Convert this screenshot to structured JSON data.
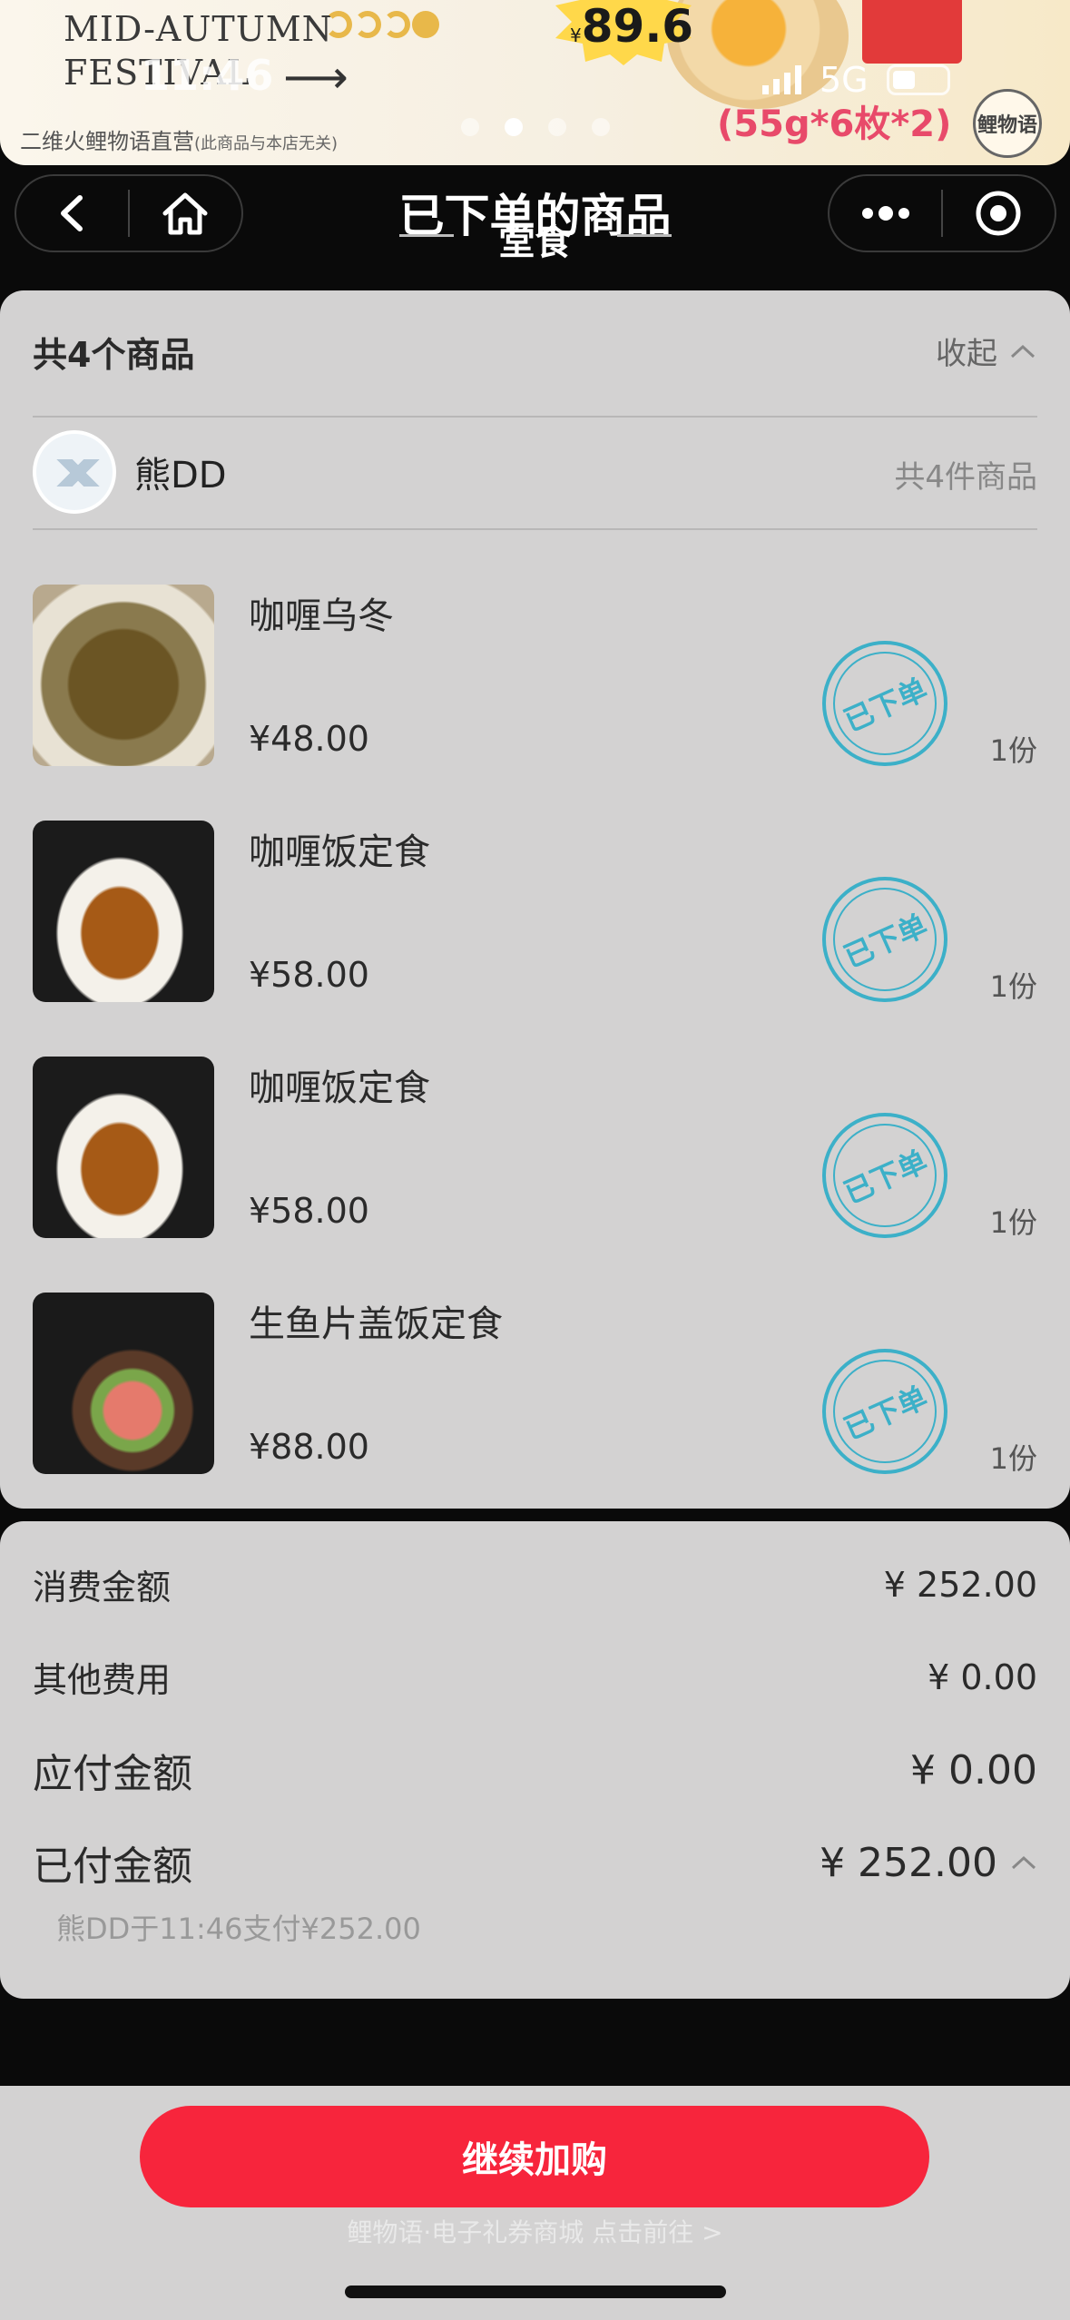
{
  "banner": {
    "headline_1": "MID-AUTUMN",
    "headline_2": "FESTIVAL",
    "shop": "二维火鲤物语直营",
    "shop_note": "(此商品与本店无关)",
    "price_prefix": "¥",
    "price": "89.6",
    "spec": "(55g*6枚*2)",
    "logo": "鲤物语",
    "status_time": "11:46",
    "network": "5G"
  },
  "nav": {
    "title": "已下单的商品",
    "subtitle": "堂食"
  },
  "order": {
    "summary": "共4个商品",
    "collapse_label": "收起",
    "user_name": "熊DD",
    "user_count": "共4件商品",
    "stamp_text": "已下单",
    "items": [
      {
        "name": "咖喱乌冬",
        "price": "¥48.00",
        "qty": "1份"
      },
      {
        "name": "咖喱饭定食",
        "price": "¥58.00",
        "qty": "1份"
      },
      {
        "name": "咖喱饭定食",
        "price": "¥58.00",
        "qty": "1份"
      },
      {
        "name": "生鱼片盖饭定食",
        "price": "¥88.00",
        "qty": "1份"
      }
    ]
  },
  "totals": {
    "consume_label": "消费金额",
    "consume_value": "¥ 252.00",
    "other_label": "其他费用",
    "other_value": "¥ 0.00",
    "payable_label": "应付金额",
    "payable_value": "¥ 0.00",
    "paid_label": "已付金额",
    "paid_value": "¥ 252.00",
    "paid_note": "熊DD于11:46支付¥252.00"
  },
  "bottom": {
    "cta": "继续加购",
    "footer": "鲤物语·电子礼券商城 点击前往 >"
  },
  "colors": {
    "accent": "#f7253c",
    "stamp": "#3cb0c8",
    "card": "#d3d2d2"
  }
}
